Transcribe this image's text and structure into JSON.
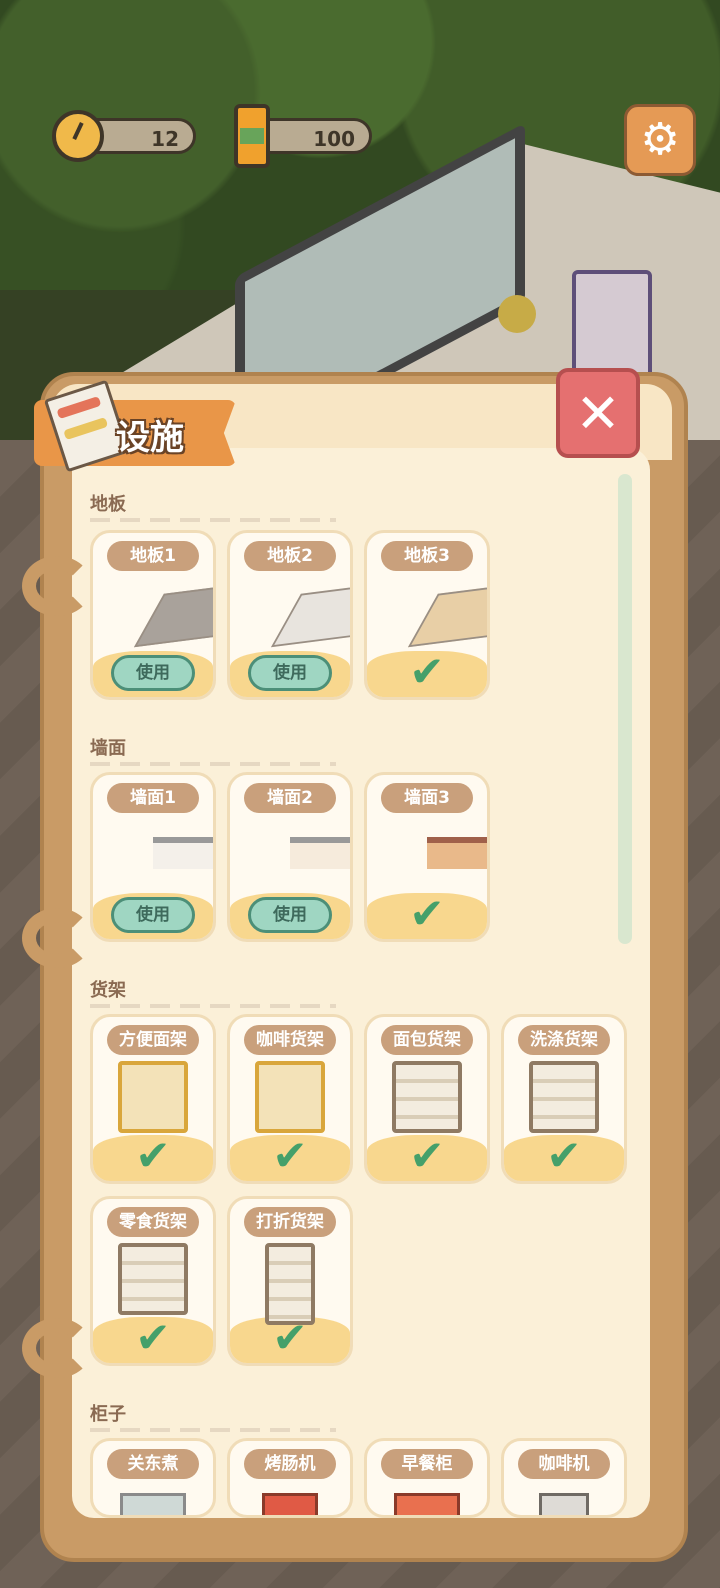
{
  "hud": {
    "clock_value": "12",
    "can_value": "100",
    "settings_icon": "gear-icon"
  },
  "panel": {
    "title": "设施",
    "close_icon": "close-icon"
  },
  "sections": [
    {
      "title": "地板",
      "items": [
        {
          "label": "地板1",
          "state": "use",
          "button": "使用",
          "color": "#a9a29b"
        },
        {
          "label": "地板2",
          "state": "use",
          "button": "使用",
          "color": "#e8e4de"
        },
        {
          "label": "地板3",
          "state": "equipped",
          "color": "#e8cfa6"
        }
      ]
    },
    {
      "title": "墙面",
      "items": [
        {
          "label": "墙面1",
          "state": "use",
          "button": "使用",
          "color": "#f4f0ea"
        },
        {
          "label": "墙面2",
          "state": "use",
          "button": "使用",
          "color": "#f6ebdc"
        },
        {
          "label": "墙面3",
          "state": "equipped",
          "color": "#e9b98a"
        }
      ]
    },
    {
      "title": "货架",
      "items": [
        {
          "label": "方便面架",
          "state": "equipped"
        },
        {
          "label": "咖啡货架",
          "state": "equipped"
        },
        {
          "label": "面包货架",
          "state": "equipped"
        },
        {
          "label": "洗涤货架",
          "state": "equipped"
        },
        {
          "label": "零食货架",
          "state": "equipped"
        },
        {
          "label": "打折货架",
          "state": "equipped"
        }
      ]
    },
    {
      "title": "柜子",
      "items": [
        {
          "label": "关东煮"
        },
        {
          "label": "烤肠机"
        },
        {
          "label": "早餐柜"
        },
        {
          "label": "咖啡机"
        }
      ]
    }
  ]
}
